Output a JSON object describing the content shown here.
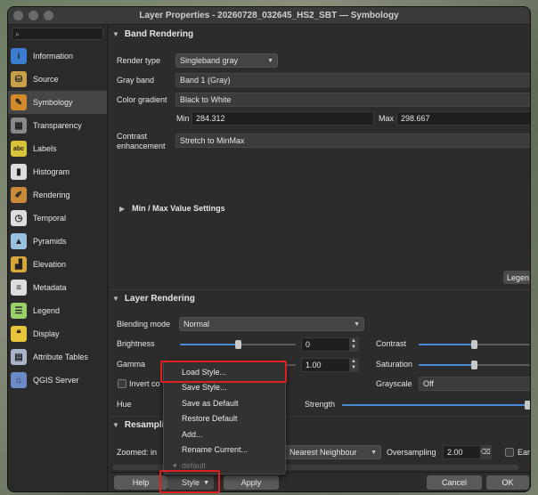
{
  "window": {
    "title": "Layer Properties - 20260728_032645_HS2_SBT — Symbology"
  },
  "sidebar": {
    "search_placeholder": "",
    "items": [
      {
        "label": "Information",
        "icon": "info-icon",
        "color": "#3b7ed0"
      },
      {
        "label": "Source",
        "icon": "source-icon",
        "color": "#c9a04a"
      },
      {
        "label": "Symbology",
        "icon": "paintbrush-icon",
        "color": "#d28a2a"
      },
      {
        "label": "Transparency",
        "icon": "transparency-icon",
        "color": "#888888"
      },
      {
        "label": "Labels",
        "icon": "abc-icon",
        "color": "#d8c23a"
      },
      {
        "label": "Histogram",
        "icon": "histogram-icon",
        "color": "#dddddd"
      },
      {
        "label": "Rendering",
        "icon": "rendering-icon",
        "color": "#c98a3a"
      },
      {
        "label": "Temporal",
        "icon": "clock-icon",
        "color": "#dddddd"
      },
      {
        "label": "Pyramids",
        "icon": "pyramids-icon",
        "color": "#9ac0e0"
      },
      {
        "label": "Elevation",
        "icon": "elevation-icon",
        "color": "#d8a73a"
      },
      {
        "label": "Metadata",
        "icon": "metadata-icon",
        "color": "#dddddd"
      },
      {
        "label": "Legend",
        "icon": "legend-icon",
        "color": "#9ad06a"
      },
      {
        "label": "Display",
        "icon": "display-icon",
        "color": "#e8c43a"
      },
      {
        "label": "Attribute Tables",
        "icon": "table-icon",
        "color": "#aab4c8"
      },
      {
        "label": "QGIS Server",
        "icon": "server-icon",
        "color": "#6a8ac8"
      }
    ]
  },
  "band_rendering": {
    "header": "Band Rendering",
    "render_type_label": "Render type",
    "render_type_value": "Singleband gray",
    "gray_band_label": "Gray band",
    "gray_band_value": "Band 1 (Gray)",
    "color_gradient_label": "Color gradient",
    "color_gradient_value": "Black to White",
    "min_label": "Min",
    "min_value": "284.312",
    "max_label": "Max",
    "max_value": "298.667",
    "contrast_label_1": "Contrast",
    "contrast_label_2": "enhancement",
    "contrast_value": "Stretch to MinMax",
    "minmax_settings": "Min / Max Value Settings",
    "legend_button": "Legen"
  },
  "layer_rendering": {
    "header": "Layer Rendering",
    "blending_label": "Blending mode",
    "blending_value": "Normal",
    "brightness_label": "Brightness",
    "brightness_value": "0",
    "brightness_level": 0.5,
    "contrast_label": "Contrast",
    "contrast_level": 0.5,
    "gamma_label": "Gamma",
    "gamma_value": "1.00",
    "gamma_level": 0.1,
    "saturation_label": "Saturation",
    "saturation_level": 0.5,
    "invert_label": "Invert co",
    "grayscale_label": "Grayscale",
    "grayscale_value": "Off",
    "hue_label": "Hue",
    "strength_label": "Strength",
    "strength_level": 1.0
  },
  "resampling": {
    "header": "Resampli",
    "zoomed_in_label": "Zoomed: in",
    "zoomed_in_value": "Nearest Neighbour",
    "oversampling_label": "Oversampling",
    "oversampling_value": "2.00",
    "early_label": "Early"
  },
  "bottom": {
    "help": "Help",
    "style": "Style",
    "apply": "Apply",
    "cancel": "Cancel",
    "ok": "OK"
  },
  "style_menu": {
    "items": [
      "Load Style...",
      "Save Style...",
      "Save as Default",
      "Restore Default",
      "Add...",
      "Rename Current..."
    ],
    "current_style": "default"
  },
  "colors": {
    "highlight_box": "#e02020",
    "slider_fill": "#4a8bd6"
  }
}
